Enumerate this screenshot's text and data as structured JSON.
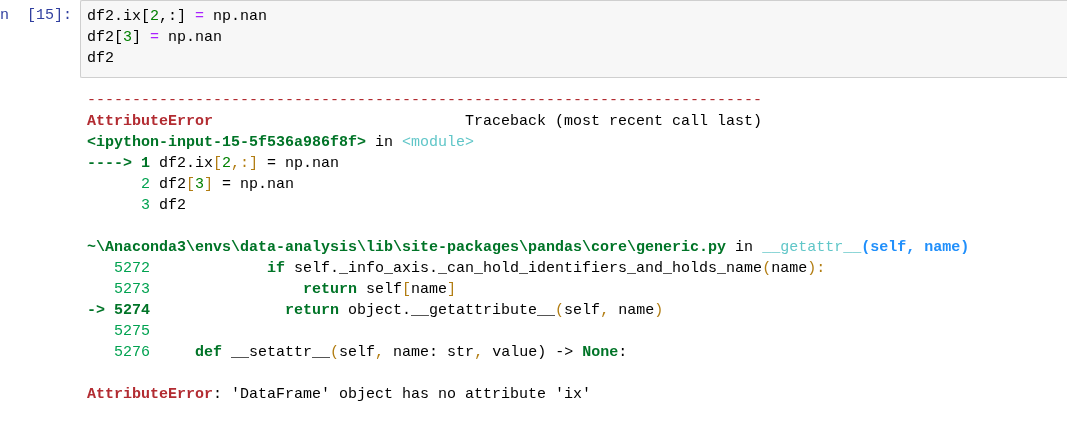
{
  "cell": {
    "prompt": "n  [15]:",
    "input_lines": [
      [
        {
          "text": "df2.ix[",
          "kind": "plain"
        },
        {
          "text": "2",
          "kind": "num"
        },
        {
          "text": ",:] ",
          "kind": "plain"
        },
        {
          "text": "=",
          "kind": "op"
        },
        {
          "text": " np.nan",
          "kind": "plain"
        }
      ],
      [
        {
          "text": "df2[",
          "kind": "plain"
        },
        {
          "text": "3",
          "kind": "num"
        },
        {
          "text": "] ",
          "kind": "plain"
        },
        {
          "text": "=",
          "kind": "op"
        },
        {
          "text": " np.nan",
          "kind": "plain"
        }
      ],
      [
        {
          "text": "df2",
          "kind": "plain"
        }
      ]
    ],
    "output_blocks": [
      [
        [
          {
            "text": "---------------------------------------------------------------------------",
            "kind": "red"
          }
        ],
        [
          {
            "text": "AttributeError",
            "kind": "redbold"
          },
          {
            "text": "                            Traceback (most recent call last)",
            "kind": "plain"
          }
        ],
        [
          {
            "text": "<ipython-input-15-5f536a986f8f>",
            "kind": "green"
          },
          {
            "text": " in ",
            "kind": "plain"
          },
          {
            "text": "<module>",
            "kind": "cyan"
          }
        ],
        [
          {
            "text": "----> 1",
            "kind": "green"
          },
          {
            "text": " df2.ix",
            "kind": "plain"
          },
          {
            "text": "[",
            "kind": "bracket"
          },
          {
            "text": "2",
            "kind": "num"
          },
          {
            "text": ",:]",
            "kind": "bracket"
          },
          {
            "text": " = np.nan",
            "kind": "plain"
          }
        ],
        [
          {
            "text": "      2",
            "kind": "lineno"
          },
          {
            "text": " df2",
            "kind": "plain"
          },
          {
            "text": "[",
            "kind": "bracket"
          },
          {
            "text": "3",
            "kind": "num"
          },
          {
            "text": "]",
            "kind": "bracket"
          },
          {
            "text": " = np.nan",
            "kind": "plain"
          }
        ],
        [
          {
            "text": "      3",
            "kind": "lineno"
          },
          {
            "text": " df2",
            "kind": "plain"
          }
        ]
      ],
      [
        [
          {
            "text": "~\\Anaconda3\\envs\\data-analysis\\lib\\site-packages\\pandas\\core\\generic.py",
            "kind": "green"
          },
          {
            "text": " in ",
            "kind": "plain"
          },
          {
            "text": "__getattr__",
            "kind": "cyan"
          },
          {
            "text": "(self, name)",
            "kind": "blue"
          }
        ],
        [
          {
            "text": "   5272",
            "kind": "lineno"
          },
          {
            "text": "             if",
            "kind": "green"
          },
          {
            "text": " self._info_axis._can_hold_identifiers_and_holds_name",
            "kind": "plain"
          },
          {
            "text": "(",
            "kind": "bracket"
          },
          {
            "text": "name",
            "kind": "plain"
          },
          {
            "text": "):",
            "kind": "bracket"
          }
        ],
        [
          {
            "text": "   5273",
            "kind": "lineno"
          },
          {
            "text": "                 return",
            "kind": "green"
          },
          {
            "text": " self",
            "kind": "plain"
          },
          {
            "text": "[",
            "kind": "bracket"
          },
          {
            "text": "name",
            "kind": "plain"
          },
          {
            "text": "]",
            "kind": "bracket"
          }
        ],
        [
          {
            "text": "-> 5274",
            "kind": "green"
          },
          {
            "text": "               return",
            "kind": "green"
          },
          {
            "text": " object.__getattribute__",
            "kind": "plain"
          },
          {
            "text": "(",
            "kind": "bracket"
          },
          {
            "text": "self",
            "kind": "plain"
          },
          {
            "text": ",",
            "kind": "bracket"
          },
          {
            "text": " name",
            "kind": "plain"
          },
          {
            "text": ")",
            "kind": "bracket"
          }
        ],
        [
          {
            "text": "   5275",
            "kind": "lineno"
          }
        ],
        [
          {
            "text": "   5276",
            "kind": "lineno"
          },
          {
            "text": "     def",
            "kind": "green"
          },
          {
            "text": " __setattr__",
            "kind": "plain"
          },
          {
            "text": "(",
            "kind": "bracket"
          },
          {
            "text": "self",
            "kind": "plain"
          },
          {
            "text": ",",
            "kind": "bracket"
          },
          {
            "text": " name: str",
            "kind": "plain"
          },
          {
            "text": ",",
            "kind": "bracket"
          },
          {
            "text": " value) -> ",
            "kind": "plain"
          },
          {
            "text": "None",
            "kind": "green"
          },
          {
            "text": ":",
            "kind": "plain"
          }
        ]
      ],
      [
        [
          {
            "text": "AttributeError",
            "kind": "redbold"
          },
          {
            "text": ": 'DataFrame' object has no attribute 'ix'",
            "kind": "plain"
          }
        ]
      ]
    ]
  }
}
